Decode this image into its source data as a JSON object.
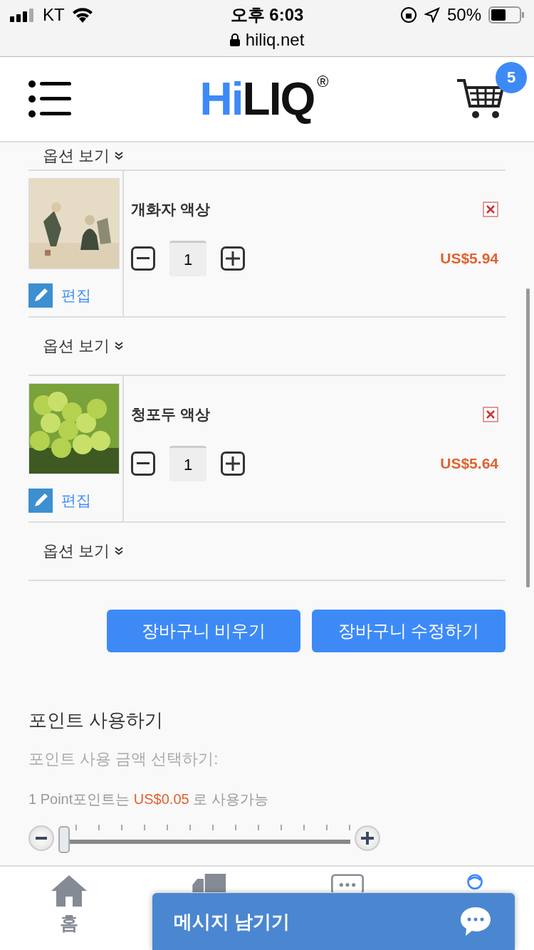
{
  "status_bar": {
    "carrier": "KT",
    "time": "오후 6:03",
    "battery": "50%",
    "url": "hiliq.net"
  },
  "header": {
    "logo_hi": "Hi",
    "logo_liq": "LIQ",
    "logo_mark": "®",
    "cart_count": "5"
  },
  "cart": {
    "top_option": "옵션 보기",
    "items": [
      {
        "name": "개화자 액상",
        "quantity": "1",
        "price": "US$5.94",
        "edit": "편집",
        "options": "옵션 보기"
      },
      {
        "name": "청포두 액상",
        "quantity": "1",
        "price": "US$5.64",
        "edit": "편집",
        "options": "옵션 보기"
      }
    ]
  },
  "actions": [
    "장바구니 비우기",
    "장바구니 수정하기"
  ],
  "points": {
    "title": "포인트 사용하기",
    "label": "포인트 사용 금액 선택하기:",
    "rate_before": "1 Point포인트는",
    "rate_value": "US$0.05",
    "rate_after": "로 사용가능",
    "slider": {
      "level": 0
    }
  },
  "bottom_nav": [
    {
      "kind": "home",
      "label": "홈",
      "selected": false
    },
    {
      "kind": "truck",
      "selected": false
    },
    {
      "kind": "chat",
      "selected": false
    },
    {
      "kind": "person",
      "selected": true
    }
  ],
  "message_button": {
    "label": "메시지 남기기"
  }
}
